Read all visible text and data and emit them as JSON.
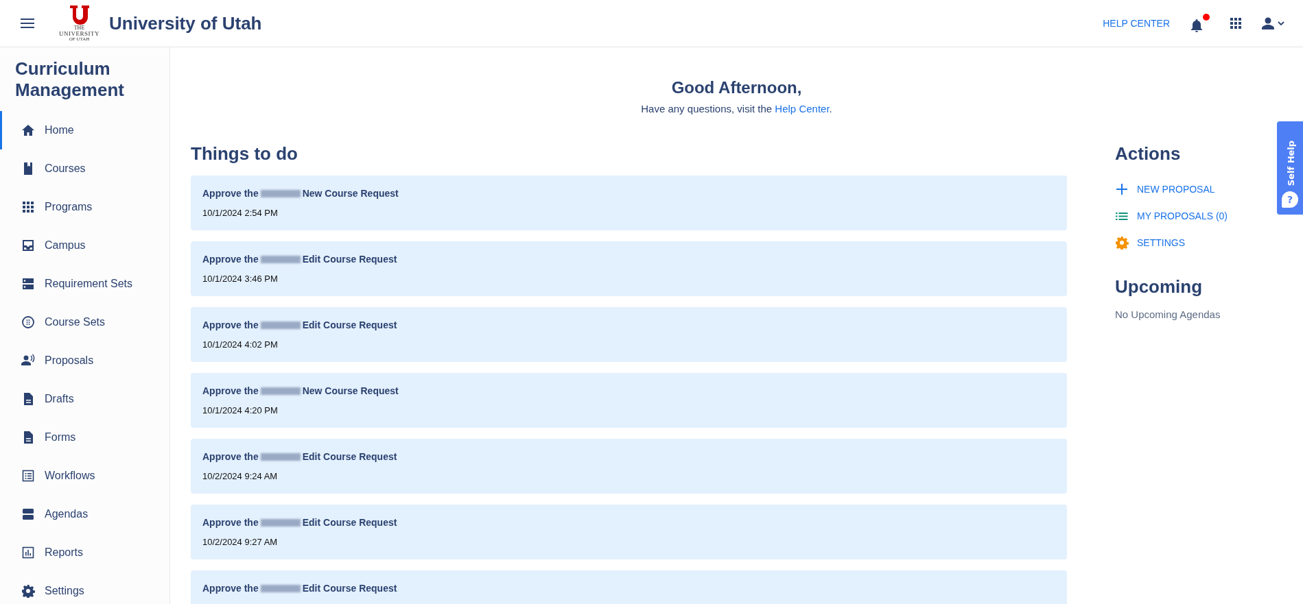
{
  "header": {
    "org_name": "University of Utah",
    "logo": {
      "line1": "THE",
      "line2": "UNIVERSITY",
      "line3": "OF UTAH"
    },
    "help_link": "HELP CENTER",
    "notifications": {
      "unread": true
    }
  },
  "sidebar": {
    "title": "Curriculum Management",
    "items": [
      {
        "label": "Home",
        "kind": "home",
        "selected": true
      },
      {
        "label": "Courses",
        "kind": "book",
        "selected": false
      },
      {
        "label": "Programs",
        "kind": "grid",
        "selected": false
      },
      {
        "label": "Campus",
        "kind": "inbox",
        "selected": false
      },
      {
        "label": "Requirement Sets",
        "kind": "storage",
        "selected": false
      },
      {
        "label": "Course Sets",
        "kind": "dots",
        "selected": false
      },
      {
        "label": "Proposals",
        "kind": "voice",
        "selected": false
      },
      {
        "label": "Drafts",
        "kind": "doc",
        "selected": false
      },
      {
        "label": "Forms",
        "kind": "doc",
        "selected": false
      },
      {
        "label": "Workflows",
        "kind": "list",
        "selected": false
      },
      {
        "label": "Agendas",
        "kind": "stack",
        "selected": false
      },
      {
        "label": "Reports",
        "kind": "chart",
        "selected": false
      },
      {
        "label": "Settings",
        "kind": "gear",
        "selected": false
      }
    ]
  },
  "greeting": {
    "title": "Good Afternoon,",
    "text_before": "Have any questions, visit the",
    "link": "Help Center",
    "text_after": "."
  },
  "things_to_do": {
    "title": "Things to do",
    "items": [
      {
        "prefix": "Approve the",
        "suffix": "New Course Request",
        "date": "10/1/2024 2:54 PM"
      },
      {
        "prefix": "Approve the",
        "suffix": "Edit Course Request",
        "date": "10/1/2024 3:46 PM"
      },
      {
        "prefix": "Approve the",
        "suffix": "Edit Course Request",
        "date": "10/1/2024 4:02 PM"
      },
      {
        "prefix": "Approve the",
        "suffix": "New Course Request",
        "date": "10/1/2024 4:20 PM"
      },
      {
        "prefix": "Approve the",
        "suffix": "Edit Course Request",
        "date": "10/2/2024 9:24 AM"
      },
      {
        "prefix": "Approve the",
        "suffix": "Edit Course Request",
        "date": "10/2/2024 9:27 AM"
      },
      {
        "prefix": "Approve the",
        "suffix": "Edit Course Request"
      }
    ]
  },
  "actions": {
    "title": "Actions",
    "items": [
      {
        "label": "NEW PROPOSAL",
        "kind": "plus"
      },
      {
        "label": "MY PROPOSALS (0)",
        "kind": "list"
      },
      {
        "label": "SETTINGS",
        "kind": "gear"
      }
    ]
  },
  "upcoming": {
    "title": "Upcoming",
    "empty_text": "No Upcoming Agendas"
  },
  "self_help": {
    "label": "Self Help",
    "icon_glyph": "?"
  }
}
